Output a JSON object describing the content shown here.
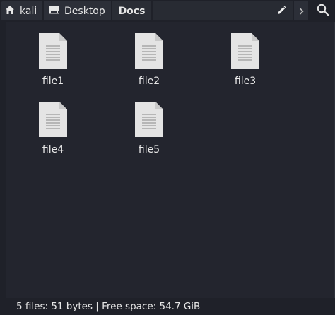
{
  "pathbar": {
    "crumbs": [
      {
        "label": "kali",
        "icon": "home-icon"
      },
      {
        "label": "Desktop",
        "icon": "desktop-icon"
      },
      {
        "label": "Docs"
      }
    ],
    "edit_icon": "pencil-icon",
    "next_icon": "chevron-right-icon",
    "search_icon": "search-icon"
  },
  "files": [
    {
      "name": "file1",
      "icon": "text-document-icon"
    },
    {
      "name": "file2",
      "icon": "text-document-icon"
    },
    {
      "name": "file3",
      "icon": "text-document-icon"
    },
    {
      "name": "file4",
      "icon": "text-document-icon"
    },
    {
      "name": "file5",
      "icon": "text-document-icon"
    }
  ],
  "statusbar": {
    "text": "5 files: 51 bytes  |  Free space: 54.7 GiB"
  },
  "colors": {
    "background": "#23252e",
    "toolbar": "#1f2129",
    "crumb": "#2c2f38",
    "text": "#e6e6e6",
    "icon_paper": "#e4e4e4"
  }
}
